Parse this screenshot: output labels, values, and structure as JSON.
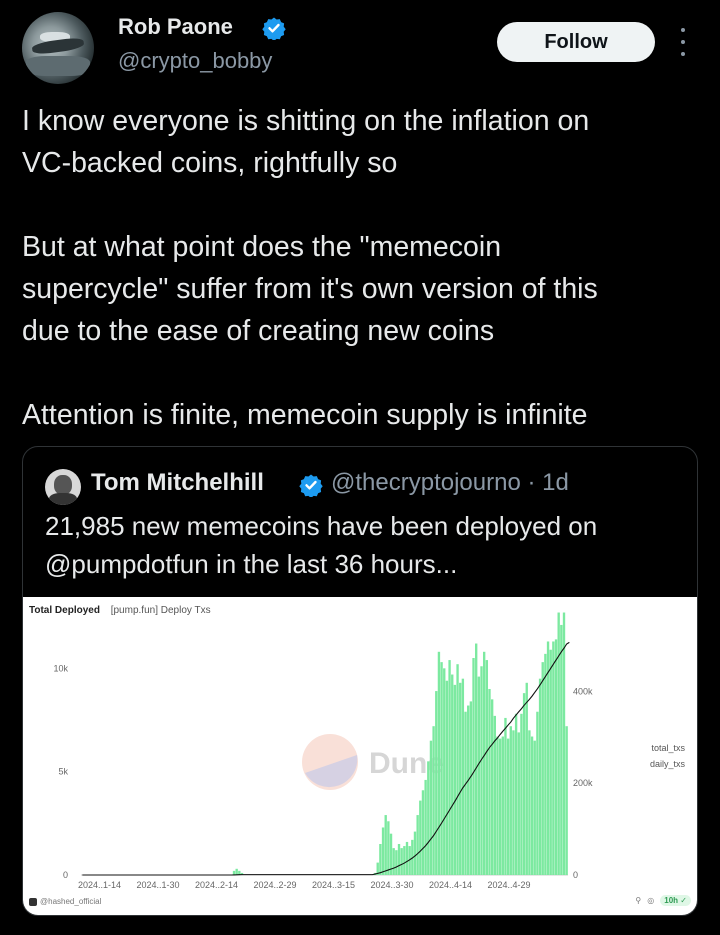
{
  "tweet": {
    "author_name": "Rob Paone",
    "author_handle": "@crypto_bobby",
    "follow_label": "Follow",
    "paragraphs": [
      "I know everyone is shitting on the inflation on\nVC-backed coins, rightfully so",
      "But at what point does the \"memecoin\nsupercycle\" suffer from it's own version of this\ndue to the ease of creating new coins",
      "Attention is finite, memecoin supply is infinite"
    ]
  },
  "quote": {
    "author_name": "Tom Mitchelhill",
    "author_handle": "@thecryptojourno",
    "separator": "·",
    "time": "1d",
    "text": "21,985 new memecoins have been deployed on\n@pumpdotfun in the last 36 hours..."
  },
  "colors": {
    "accent_verified": "#1d9bf0",
    "bar_green": "#7ce9a0",
    "line_black": "#111111"
  },
  "chart_card": {
    "title": "Total Deployed",
    "subtitle": "[pump.fun] Deploy Txs",
    "watermark": "Dune",
    "footer_source": "@hashed_official",
    "footer_age": "10h"
  },
  "chart_data": {
    "type": "bar",
    "x_tick_labels": [
      "2024..1-14",
      "2024..1-30",
      "2024..2-14",
      "2024..2-29",
      "2024..3-15",
      "2024..3-30",
      "2024..4-14",
      "2024..4-29"
    ],
    "left_ticks": [
      "0",
      "5k",
      "10k"
    ],
    "right_ticks": [
      "0",
      "200k",
      "400k"
    ],
    "ylim_left": [
      0,
      12000
    ],
    "ylim_right": [
      0,
      540000
    ],
    "legend": [
      {
        "name": "total_txs",
        "color": "#111111"
      },
      {
        "name": "daily_txs",
        "color": "#7ce9a0"
      }
    ],
    "daily_txs": [
      0,
      0,
      0,
      0,
      0,
      0,
      0,
      0,
      0,
      0,
      0,
      0,
      0,
      0,
      0,
      0,
      0,
      0,
      0,
      0,
      0,
      0,
      0,
      0,
      0,
      0,
      0,
      0,
      0,
      0,
      0,
      0,
      0,
      0,
      0,
      0,
      0,
      0,
      0,
      0,
      0,
      0,
      0,
      0,
      0,
      0,
      0,
      0,
      0,
      0,
      0,
      0,
      0,
      0,
      0,
      0,
      0,
      200,
      300,
      200,
      100,
      0,
      0,
      0,
      0,
      0,
      0,
      0,
      0,
      0,
      0,
      0,
      0,
      0,
      0,
      0,
      0,
      0,
      0,
      0,
      0,
      0,
      0,
      0,
      0,
      0,
      0,
      0,
      0,
      0,
      0,
      0,
      0,
      0,
      0,
      0,
      0,
      0,
      0,
      0,
      0,
      0,
      0,
      0,
      0,
      0,
      0,
      0,
      0,
      0,
      100,
      600,
      1500,
      2300,
      2900,
      2600,
      2000,
      1300,
      1200,
      1500,
      1300,
      1400,
      1600,
      1400,
      1700,
      2100,
      2900,
      3600,
      4100,
      4600,
      5500,
      6500,
      7200,
      8900,
      10800,
      10300,
      10000,
      9400,
      10400,
      9700,
      9200,
      10200,
      9300,
      9500,
      7900,
      8200,
      8400,
      10500,
      11200,
      9600,
      10100,
      10800,
      10400,
      9000,
      8500,
      7700,
      6700,
      6600,
      6700,
      7600,
      6600,
      7200,
      7000,
      7800,
      6900,
      7800,
      8800,
      9300,
      7000,
      6700,
      6500,
      7900,
      9500,
      10300,
      10700,
      11300,
      10900,
      11300,
      11400,
      12700,
      12100,
      12700,
      7200
    ],
    "total_txs": [
      0,
      0,
      0,
      0,
      0,
      0,
      0,
      0,
      0,
      0,
      0,
      0,
      0,
      0,
      0,
      0,
      0,
      0,
      0,
      0,
      0,
      0,
      0,
      0,
      0,
      0,
      0,
      0,
      0,
      0,
      0,
      0,
      0,
      0,
      0,
      0,
      0,
      0,
      0,
      0,
      0,
      0,
      0,
      0,
      0,
      0,
      0,
      0,
      0,
      0,
      0,
      0,
      0,
      0,
      0,
      0,
      0,
      200,
      500,
      700,
      800,
      800,
      800,
      800,
      800,
      800,
      800,
      800,
      800,
      800,
      800,
      800,
      800,
      800,
      800,
      800,
      800,
      800,
      800,
      800,
      800,
      800,
      800,
      800,
      800,
      800,
      800,
      800,
      800,
      800,
      800,
      800,
      800,
      800,
      800,
      800,
      800,
      800,
      800,
      800,
      800,
      800,
      800,
      800,
      800,
      800,
      800,
      800,
      800,
      800,
      2000,
      3500,
      5000,
      7000,
      9000,
      11000,
      13000,
      15000,
      17500,
      20500,
      23000,
      26000,
      29500,
      33000,
      37000,
      41500,
      46500,
      52000,
      58000,
      64000,
      71000,
      78500,
      86000,
      95000,
      104000,
      113000,
      122500,
      132000,
      141500,
      151000,
      160500,
      170500,
      180500,
      190000,
      198000,
      206000,
      214500,
      223500,
      233000,
      242500,
      251500,
      260000,
      269000,
      277500,
      284500,
      292000,
      298500,
      306000,
      313000,
      319500,
      326500,
      333000,
      341500,
      348500,
      355500,
      362000,
      369500,
      376000,
      382500,
      389500,
      397500,
      405500,
      414000,
      423000,
      432000,
      441000,
      450000,
      459000,
      468000,
      477000,
      486000,
      494000,
      503000,
      506500
    ]
  }
}
